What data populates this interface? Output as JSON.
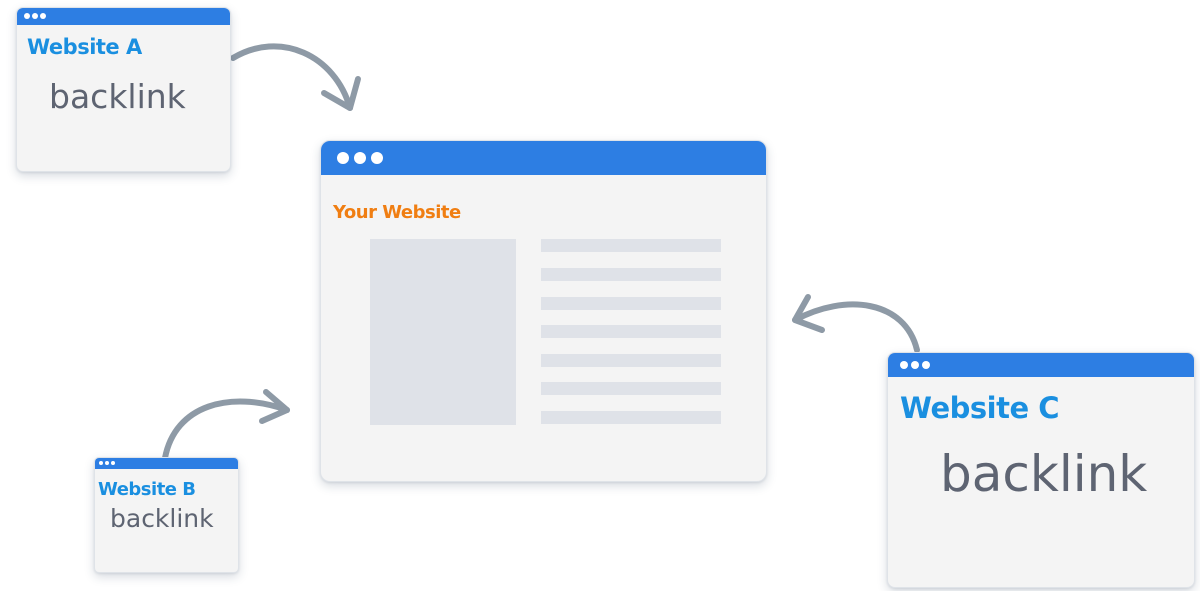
{
  "website_a": {
    "title": "Website A",
    "label": "backlink"
  },
  "website_b": {
    "title": "Website B",
    "label": "backlink"
  },
  "website_c": {
    "title": "Website C",
    "label": "backlink"
  },
  "main_site": {
    "title": "Your Website"
  },
  "colors": {
    "titlebar": "#2d7ee3",
    "backlink_title": "#1a8fe0",
    "main_title": "#f07e12",
    "arrow": "#8e9aa6",
    "placeholder": "#dfe2e8"
  }
}
